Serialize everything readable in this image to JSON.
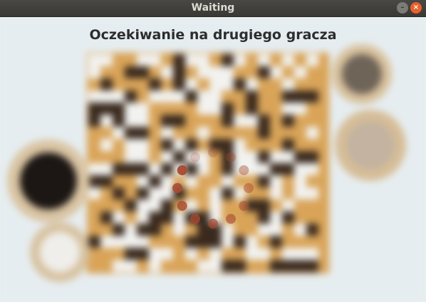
{
  "window": {
    "title": "Waiting",
    "minimize_icon": "minimize-icon",
    "close_icon": "close-icon"
  },
  "main": {
    "heading": "Oczekiwanie na drugiego gracza",
    "background": "go-board-photo",
    "spinner_icon": "loading-spinner-icon"
  },
  "colors": {
    "spinner": "#a84a32",
    "titlebar": "#3c3b37",
    "close": "#e9612c"
  }
}
